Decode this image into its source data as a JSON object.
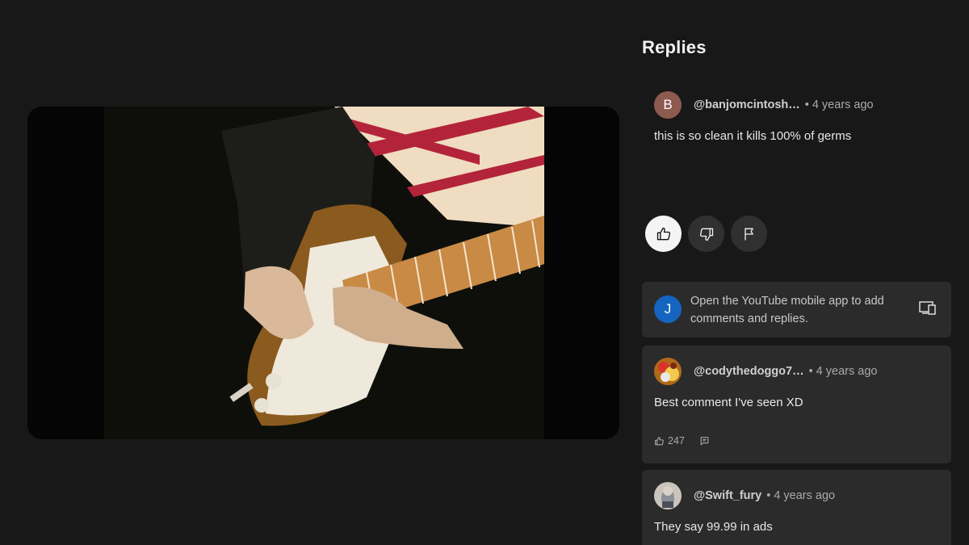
{
  "panel": {
    "title": "Replies"
  },
  "main_comment": {
    "avatar_letter": "B",
    "handle": "@banjomcintosh…",
    "time": "4 years ago",
    "text": "this is so clean it kills 100% of germs"
  },
  "actions": {
    "like_icon": "thumbs-up-icon",
    "dislike_icon": "thumbs-down-icon",
    "report_icon": "flag-icon"
  },
  "app_prompt": {
    "avatar_letter": "J",
    "message": "Open the YouTube mobile app to add comments and replies.",
    "icon": "device-cast-icon"
  },
  "replies": [
    {
      "handle": "@codythedoggo7…",
      "time": "4 years ago",
      "text": "Best comment I've seen XD",
      "likes": "247"
    },
    {
      "handle": "@Swift_fury",
      "time": "4 years ago",
      "text": "They say 99.99 in ads"
    }
  ],
  "colors": {
    "background": "#181818",
    "card": "#2b2b2b",
    "button": "#303030",
    "active_button": "#f4f4f4",
    "avatar_b": "#8d5a4f",
    "avatar_j": "#1565c0"
  }
}
